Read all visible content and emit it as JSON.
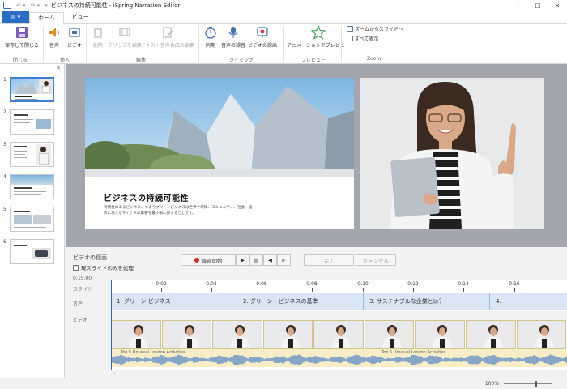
{
  "window": {
    "title": "ビジネスの持続可能性 - iSpring Narration Editor",
    "file_tab_label": "",
    "tabs": [
      "ホーム",
      "ビュー"
    ]
  },
  "ribbon": {
    "save_close": "保存して閉じる",
    "group_close": "閉じる",
    "audio": "音声",
    "video": "ビデオ",
    "group_insert": "挿入",
    "delete": "削除",
    "clip_edit": "クリップを編集",
    "tts_edit": "テキスト音声合成の編集",
    "group_edit": "編集",
    "sync": "同期",
    "record_audio": "音声の録音",
    "record_video": "ビデオの録画",
    "group_timing": "タイミング",
    "animation_preview": "アニメーションでプレビュー",
    "group_preview": "プレビュー",
    "zoom_to_slide": "ズームからスライドへ",
    "show_all": "すべて表示",
    "group_zoom": "Zoom"
  },
  "sidebar": {
    "slides": [
      "1",
      "2",
      "3",
      "4",
      "5",
      "6"
    ]
  },
  "slide": {
    "title": "ビジネスの持続可能性",
    "body": "持続性のあるビジネス、つまりグリーンビジネスは世界や環境、コミュニティ、社会、経済に与えるマイナスの影響を最小限に抑えることです。"
  },
  "recording": {
    "title": "ビデオの録画",
    "checkbox_label": "現スライドのみを処理",
    "checked": true,
    "start_record": "録音開始",
    "done": "完了",
    "cancel": "キャンセル"
  },
  "timeline": {
    "current_time": "0:15.00",
    "labels": {
      "slide": "スライド",
      "audio": "音声",
      "video": "ビデオ"
    },
    "ticks": [
      "0:02",
      "0:04",
      "0:06",
      "0:08",
      "0:10",
      "0:12",
      "0:14",
      "0:16"
    ],
    "audio_segments": [
      "1. グリーン ビジネス",
      "2. グリーン・ビジネスの基準",
      "3. サステナブルな企業とは？",
      "4."
    ],
    "audio_track_labels": [
      "Top 5 Unusual London Activities",
      "Top 5 Unusual London Activities"
    ]
  },
  "status": {
    "zoom": "100%"
  }
}
